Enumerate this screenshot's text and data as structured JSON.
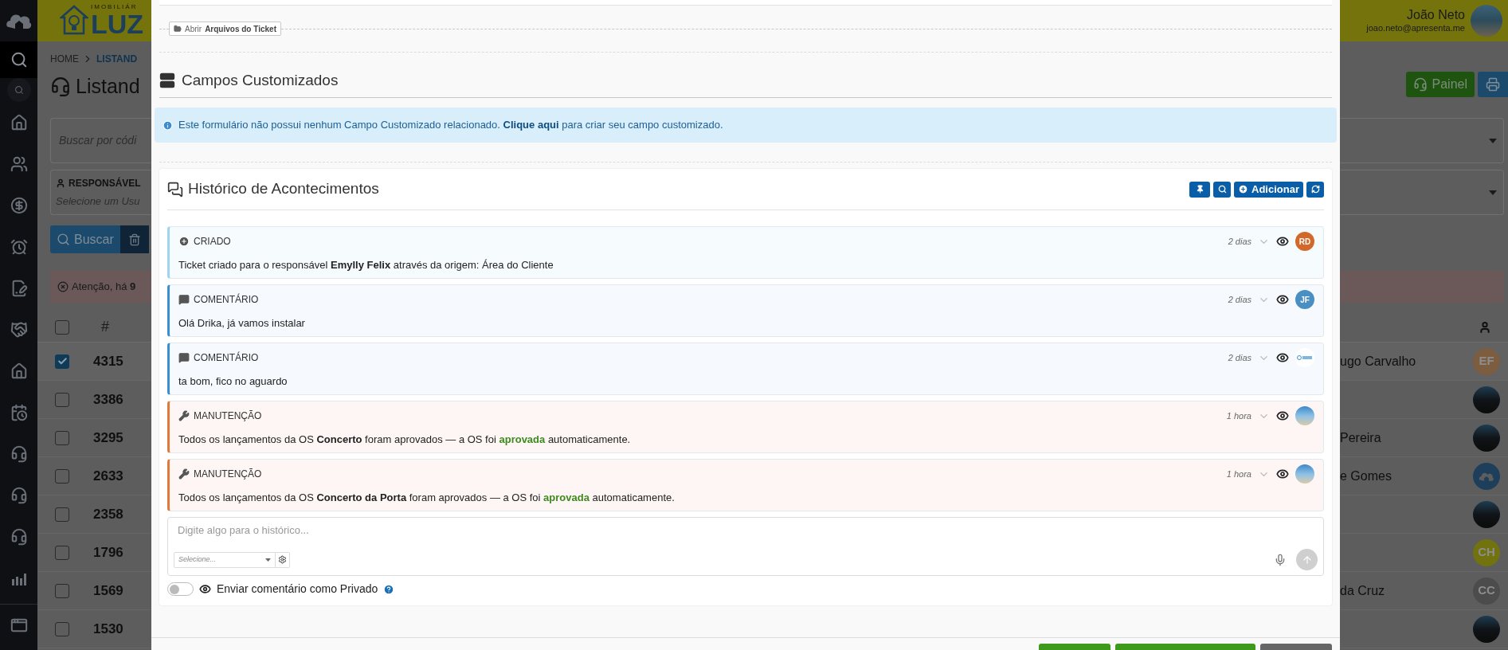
{
  "sidebar": {
    "items": [
      {
        "kind": "search",
        "selected": true
      },
      {
        "kind": "search-small",
        "selected": false
      },
      {
        "kind": "home",
        "selected": false
      },
      {
        "kind": "users",
        "selected": false
      },
      {
        "kind": "money",
        "selected": false
      },
      {
        "kind": "alarm",
        "selected": false
      },
      {
        "kind": "contract",
        "selected": false
      },
      {
        "kind": "handshake",
        "selected": false
      },
      {
        "kind": "house",
        "selected": false
      },
      {
        "kind": "calendar",
        "selected": false
      },
      {
        "kind": "headset",
        "selected": false
      },
      {
        "kind": "headset",
        "selected": false
      },
      {
        "kind": "headset",
        "selected": false
      },
      {
        "kind": "chart",
        "selected": false
      },
      {
        "kind": "window",
        "selected": false
      }
    ]
  },
  "header": {
    "logo_caption": "IMOBILIÁR",
    "logo_text": "LUZ",
    "user": {
      "name": "João Neto",
      "email": "joao.neto@apresenta.me"
    }
  },
  "page": {
    "breadcrumb": [
      "HOME",
      "LISTAND"
    ],
    "title": "Listand",
    "panel_button": "Painel",
    "search_placeholder": "Buscar por códi",
    "responsible": {
      "label": "RESPONSÁVEL",
      "placeholder": "Selecione um Usu"
    },
    "search_button": "Buscar",
    "alert": "Atenção, há **9**",
    "table": {
      "number_header": "#",
      "all_checked": false,
      "rows": [
        {
          "number": "4315",
          "checked": true,
          "responsible": "ugo Carvalho",
          "avatar": {
            "kind": "initials",
            "text": "EF",
            "color": "#7d5d3f"
          }
        },
        {
          "number": "3386",
          "checked": false,
          "avatar": {
            "kind": "photo"
          }
        },
        {
          "number": "3295",
          "checked": false,
          "responsible": "Pereira",
          "avatar": {
            "kind": "photo"
          }
        },
        {
          "number": "2633",
          "checked": false,
          "responsible": "e Gomes",
          "avatar": {
            "kind": "logo",
            "color": "#1d3f5c"
          }
        },
        {
          "number": "2358",
          "checked": false,
          "avatar": {
            "kind": "photo"
          }
        },
        {
          "number": "1796",
          "checked": false,
          "avatar": {
            "kind": "initials",
            "text": "CH",
            "color": "#72720f"
          }
        },
        {
          "number": "1569",
          "checked": false,
          "responsible": "da Cruz",
          "avatar": {
            "kind": "initials",
            "text": "CC",
            "color": "#4c4c4c"
          }
        },
        {
          "number": "1530",
          "checked": false,
          "avatar": {
            "kind": "photo"
          }
        }
      ]
    }
  },
  "modal": {
    "files_button": {
      "prefix": "Abrir",
      "label": "Arquivos do Ticket"
    },
    "custom_fields": {
      "title": "Campos Customizados",
      "alert": {
        "before": "Este formulário não possui nenhum Campo Customizado relacionado. ",
        "link": "Clique aqui",
        "after": " para criar seu campo customizado."
      }
    },
    "history": {
      "title": "Histórico de Acontecimentos",
      "add_button": "Adicionar",
      "entries": [
        {
          "kind": "created",
          "title": "CRIADO",
          "time": "2 dias",
          "body": [
            {
              "text": "Ticket criado para o responsável "
            },
            {
              "text": "Emylly Felix",
              "kind": "bold"
            },
            {
              "text": " através da origem: Área do Cliente"
            }
          ],
          "avatar": {
            "kind": "initials",
            "text": "RD",
            "color": "#d2692a"
          }
        },
        {
          "kind": "comment",
          "title": "COMENTÁRIO",
          "time": "2 dias",
          "body": [
            {
              "text": "Olá Drika, já vamos instalar"
            }
          ],
          "avatar": {
            "kind": "initials",
            "text": "JF",
            "color": "#4a8fc2"
          }
        },
        {
          "kind": "comment",
          "title": "COMENTÁRIO",
          "time": "2 dias",
          "body": [
            {
              "text": "ta bom, fico no aguardo"
            }
          ],
          "avatar": {
            "kind": "logo",
            "color": "#ffffff"
          }
        },
        {
          "kind": "maintenance",
          "title": "MANUTENÇÃO",
          "time": "1 hora",
          "body": [
            {
              "text": "Todos os lançamentos da OS "
            },
            {
              "text": "Concerto",
              "kind": "bold"
            },
            {
              "text": " foram aprovados — a OS foi "
            },
            {
              "text": "aprovada",
              "kind": "approved"
            },
            {
              "text": " automaticamente."
            }
          ],
          "avatar": {
            "kind": "photo"
          }
        },
        {
          "kind": "maintenance",
          "title": "MANUTENÇÃO",
          "time": "1 hora",
          "body": [
            {
              "text": "Todos os lançamentos da OS "
            },
            {
              "text": "Concerto da Porta",
              "kind": "bold"
            },
            {
              "text": " foram aprovados — a OS foi "
            },
            {
              "text": "aprovada",
              "kind": "approved"
            },
            {
              "text": " automaticamente."
            }
          ],
          "avatar": {
            "kind": "photo"
          }
        }
      ],
      "composer": {
        "placeholder": "Digite algo para o histórico...",
        "select_placeholder": "Selecione..."
      },
      "private_toggle": {
        "on": false,
        "label": "Enviar comentário como Privado"
      }
    },
    "footer_buttons": [
      {
        "kind": "primary"
      },
      {
        "kind": "primary"
      },
      {
        "kind": "secondary"
      }
    ]
  }
}
